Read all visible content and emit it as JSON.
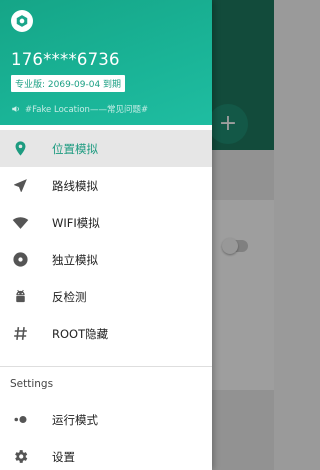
{
  "header": {
    "account_phone": "176****6736",
    "vip_badge": "专业版: 2069-09-04 到期",
    "notice": "#Fake Location——常见问题#"
  },
  "menu": [
    {
      "id": "location",
      "label": "位置模拟",
      "icon": "location-pin-icon",
      "active": true
    },
    {
      "id": "route",
      "label": "路线模拟",
      "icon": "navigation-arrow-icon",
      "active": false
    },
    {
      "id": "wifi",
      "label": "WIFI模拟",
      "icon": "wifi-icon",
      "active": false
    },
    {
      "id": "standalone",
      "label": "独立模拟",
      "icon": "disc-icon",
      "active": false
    },
    {
      "id": "anti-detect",
      "label": "反检测",
      "icon": "android-icon",
      "active": false
    },
    {
      "id": "root-hide",
      "label": "ROOT隐藏",
      "icon": "hash-icon",
      "active": false
    }
  ],
  "settings": {
    "title": "Settings",
    "items": [
      {
        "id": "run-mode",
        "label": "运行模式",
        "icon": "toggle-mode-icon"
      },
      {
        "id": "preferences",
        "label": "设置",
        "icon": "gear-icon"
      }
    ]
  },
  "colors": {
    "accent": "#1d9b80",
    "header_start": "#15a587",
    "header_end": "#1fbda1",
    "menu_icon": "#555555"
  }
}
